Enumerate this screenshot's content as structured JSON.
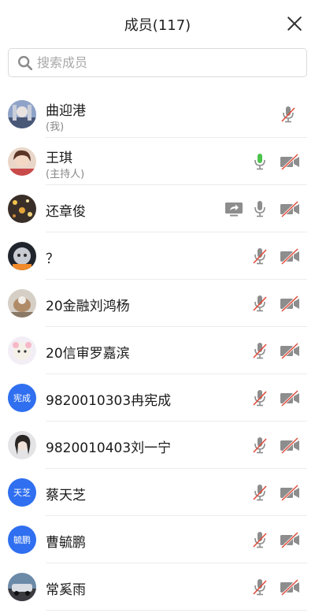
{
  "header": {
    "title": "成员(117)"
  },
  "search": {
    "placeholder": "搜索成员"
  },
  "colors": {
    "accent": "#2f6ff0",
    "mic_on": "#4cc34a",
    "muted_slash": "#e04c3c",
    "icon_gray": "#8d8d8d"
  },
  "members": [
    {
      "name": "曲迎港",
      "sub": "(我)",
      "avatar": "photo-anime",
      "mic": "muted",
      "video": null,
      "share": false
    },
    {
      "name": "王琪",
      "sub": "(主持人)",
      "avatar": "photo-girl",
      "mic": "speaking",
      "video": "off",
      "share": false
    },
    {
      "name": "还章俊",
      "avatar": "photo-lights",
      "mic": "on",
      "video": "off",
      "share": true
    },
    {
      "name": "？",
      "avatar": "photo-cat",
      "mic": "muted",
      "video": "off",
      "share": false
    },
    {
      "name": "20金融刘鸿杨",
      "avatar": "photo-animal",
      "mic": "muted",
      "video": "off",
      "share": false
    },
    {
      "name": "20信审罗嘉滨",
      "avatar": "photo-cartoon",
      "mic": "muted",
      "video": "off",
      "share": false
    },
    {
      "name": "9820010303冉宪成",
      "avatar_text": "宪成",
      "mic": "muted",
      "video": "off",
      "share": false
    },
    {
      "name": "9820010403刘一宁",
      "avatar": "photo-portrait",
      "mic": "muted",
      "video": "off",
      "share": false
    },
    {
      "name": "蔡天芝",
      "avatar_text": "天芝",
      "mic": "muted",
      "video": "off",
      "share": false
    },
    {
      "name": "曹毓鹏",
      "avatar_text": "毓鹏",
      "mic": "muted",
      "video": "off",
      "share": false
    },
    {
      "name": "常奚雨",
      "avatar": "photo-car",
      "mic": "muted",
      "video": "off",
      "share": false
    }
  ]
}
